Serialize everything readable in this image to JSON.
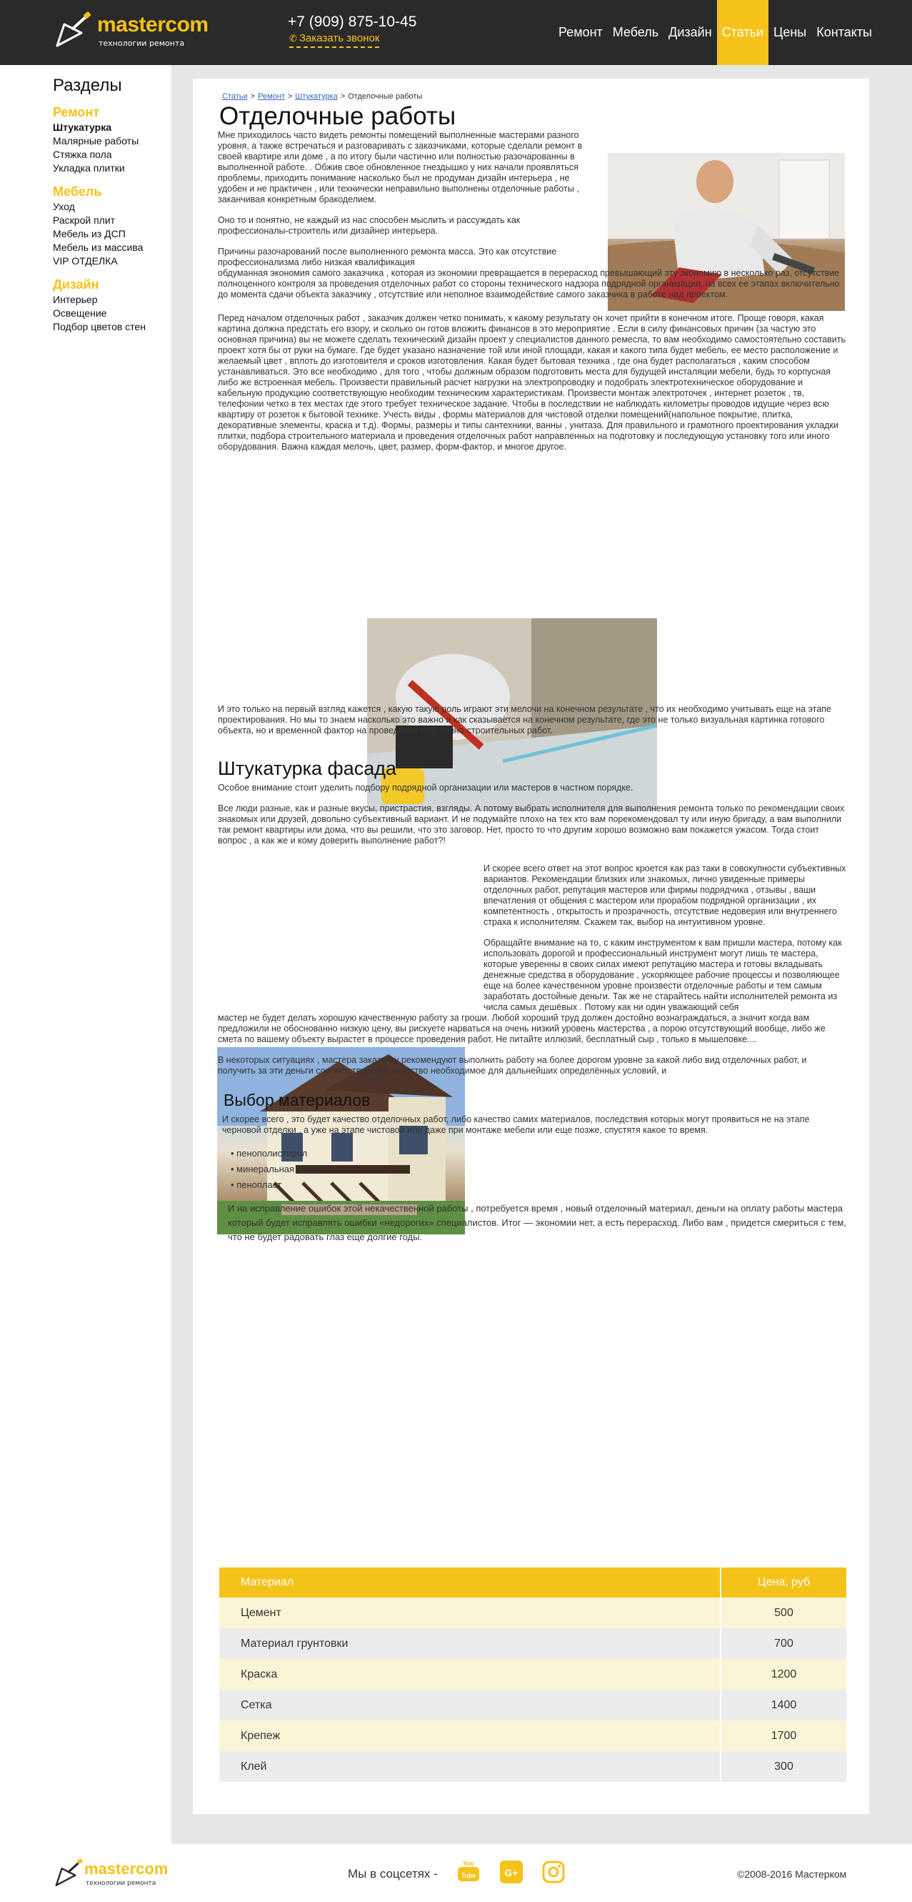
{
  "header": {
    "logo_name": "mastercom",
    "logo_tagline": "технологии ремонта",
    "phone": "+7 (909) 875-10-45",
    "callback": "Заказать звонок",
    "nav": [
      "Ремонт",
      "Мебель",
      "Дизайн",
      "Статьи",
      "Цены",
      "Контакты"
    ],
    "active_nav": "Статьи",
    "accent_color": "#f5c21a"
  },
  "sidebar": {
    "title": "Разделы",
    "groups": [
      {
        "title": "Ремонт",
        "items": [
          "Штукатурка",
          "Малярные работы",
          "Стяжка пола",
          "Укладка плитки"
        ],
        "current": "Штукатурка"
      },
      {
        "title": "Мебель",
        "items": [
          "Уход",
          "Раскрой плит",
          "Мебель из ДСП",
          "Мебель из массива",
          "VIP ОТДЕЛКА"
        ]
      },
      {
        "title": "Дизайн",
        "items": [
          "Интерьер",
          "Освещение",
          "Подбор цветов стен"
        ]
      }
    ]
  },
  "breadcrumb": {
    "items": [
      "Статьи",
      "Ремонт",
      "Штукатурка"
    ],
    "current": "Отделочные работы"
  },
  "article": {
    "title": "Отделочные работы",
    "intro_p1": "Мне приходилось часто видеть ремонты помещений выполненные мастерами разного уровня, а также встречаться и разговаривать с заказчиками, которые сделали ремонт в своей квартире или доме , а по итогу были частично или полностью разочарованны в выполненной работе. . Обжив свое обновленное гнездышко у них начали проявляться проблемы, приходить понимание насколько был не продуман дизайн интерьера , не удобен и не практичен , или технически неправильно выполнены отделочные работы , заканчивая конкретным бракоделием.",
    "intro_p2": "Оно то и понятно, не каждый из нас способен мыслить и рассуждать как профессионалы-строитель или дизайнер интерьера.",
    "intro_p3a": "Причины разочарований после выполненного ремонта масса. Это как отсутствие профессионализма либо низкая квалификация",
    "intro_p3b": "обдуманная экономия самого заказчика , которая из экономии превращается в перерасход превышающий эту экономию в несколько раз, отсутствие полноценного контроля за проведения отделочных работ со стороны технического надзора подрядной организации, на всех ее этапах включительно до момента сдачи объекта заказчику , отсутствие или неполное взаимодействие самого заказчика в работе над проектом.",
    "p4": "Перед началом отделочных работ , заказчик должен четко понимать, к какому результату он хочет прийти в конечном итоге. Проще говоря, какая картина должна предстать его взору, и сколько он готов вложить финансов в это мероприятие . Если в силу финансовых причин (за частую это основная причина) вы не можете сделать технический дизайн проект у специалистов данного ремесла, то вам необходимо самостоятельно составить проект хотя бы от руки на бумаге. Где будет указано назначение той или иной площади, какая и какого типа будет мебель, ее место расположение и желаемый цвет , вплоть до изготовителя и сроков изготовления. Какая будет бытовая техника , где она будет располагаться , каким способом устанавливаться. Это все необходимо , для того , чтобы должным образом подготовить места для будущей инсталяции мебели, будь то корпусная либо же встроенная мебель. Произвести правильный расчет нагрузки на электропроводку и подобрать электротехническое оборудование и кабельную продукцию соответствующую необходим техническим характеристикам. Произвести монтаж электроточек , интернет розеток , тв, телефонии четко в тех местах где этого требует техническое задание. Чтобы в последствии не наблюдать километры проводов идущие через всю квартиру от розеток к бытовой технике. Учесть виды , формы материалов для чистовой отделки помещений(напольное покрытие, плитка, декоративные элементы, краска и т.д). Формы, размеры и типы сантехники, ванны , унитаза. Для правильного и грамотного проектирования укладки плитки, подбора строительного материала и проведения отделочных работ направленных на подготовку и последующую установку того или иного оборудования. Важна каждая мелочь, цвет, размер, форм-фактор, и многое другое.",
    "p5": "И это только на первый взгляд кажется , какую такую роль играют эти мелочи на конечном результате , что их необходимо учитывать еще на этапе проектирования. Но мы то знаем насколько это важно и как сказывается на конечном результате, где это не только визуальная картинка готового объекта, но и временной фактор на проведение отделочно-строительных работ.",
    "section2_title": "Штукатурка фасада",
    "s2_p1": "Особое внимание стоит уделить подбору подрядной организации или мастеров в частном порядке.",
    "s2_p2": "Все люди разные, как и разные вкусы, пристрастия, взгляды. А потому выбрать исполнителя для выполнения ремонта только по рекомендации своих знакомых или друзей, довольно субъективный вариант. И не подумайте плохо на тех кто вам порекомендовал ту или иную бригаду, а вам выполнили так ремонт квартиры или дома, что вы решили, что это заговор. Нет, просто то что другим хорошо возможно вам покажется ужасом. Тогда стоит вопрос , а как же и кому доверить выполнение работ?!",
    "s2_p3": "И скорее всего ответ на этот вопрос кроется как раз таки в совокупности субъективных вариантов. Рекомендации близких или знакомых, лично увиденные примеры отделочных работ, репутация мастеров или фирмы подрядчика , отзывы , ваши впечатления от общения с мастером или прорабом подрядной организации , их компетентность , открытость и прозрачность, отсутствие недоверия или внутреннего страха к исполнителям. Скажем так, выбор на интуитивном уровне.",
    "s2_p4a": "Обращайте внимание на то, с каким инструментом к вам пришли мастера, потому как использовать дорогой и профессиональный инструмент могут лишь те мастера, которые уверенны в своих силах имеют репутацию мастера и готовы вкладывать денежные средства в оборудование , ускоряющее рабочие процессы и позволяющее еще на более качественном уровне произвести отделочные работы и тем самым заработать достойные деньги. Так же не старайтесь найти исполнителей ремонта из числа самых дешёвых . Потому как ни один уважающий себя",
    "s2_p4b": "мастер не будет делать хорошую качественную работу за гроши. Любой хороший труд должен достойно вознаграждаться, а значит когда вам предложили не обоснованно низкую цену, вы рискуете нарваться на очень низкий уровень мастерства , а порою отсутствующий вообще, либо же смета по вашему объекту вырастет в процессе проведения работ. Не питайте иллюзий, бесплатный сыр , только в мышеловке....",
    "s2_p5": "В некоторых ситуациях , мастера заказчику рекомендуют выполнить работу на более дорогом уровне за какой либо вид отделочных работ, и получить за эти деньги соответствующее качество необходимое для дальнейших определённых условий, и",
    "section3_title": "Выбор материалов",
    "s3_p1": "И скорее всего , это будет качество отделочных работ, либо качество самих материалов, последствия которых могут проявиться не на этапе черновой отделки , а уже на этапе чистовой или даже при монтаже мебели или еще позже, спустятя какое то время.",
    "materials_list": [
      "пенополистирол",
      "минеральная вата",
      "пенопласт"
    ],
    "s3_p2": "И на исправление ошибок этой некачественной работы , потребуется время , новый отделочный материал, деньги на оплату работы мастера который будет исправлять ошибки «недорогих» специалистов. Итог — экономии нет, а есть перерасход. Либо вам , придется смериться с тем, что не будет радовать глаз еще долгие годы."
  },
  "price_table": {
    "headers": [
      "Материал",
      "Цена, руб"
    ],
    "rows": [
      [
        "Цемент",
        "500"
      ],
      [
        "Материал грунтовки",
        "700"
      ],
      [
        "Краска",
        "1200"
      ],
      [
        "Сетка",
        "1400"
      ],
      [
        "Крепеж",
        "1700"
      ],
      [
        "Клей",
        "300"
      ]
    ]
  },
  "footer": {
    "logo_name": "mastercom",
    "logo_tagline": "технологии ремонта",
    "social_label": "Мы в соцсетях -",
    "social_icons": [
      "youtube-icon",
      "google-plus-icon",
      "instagram-icon"
    ],
    "copyright": "©2008-2016 Мастерком"
  }
}
